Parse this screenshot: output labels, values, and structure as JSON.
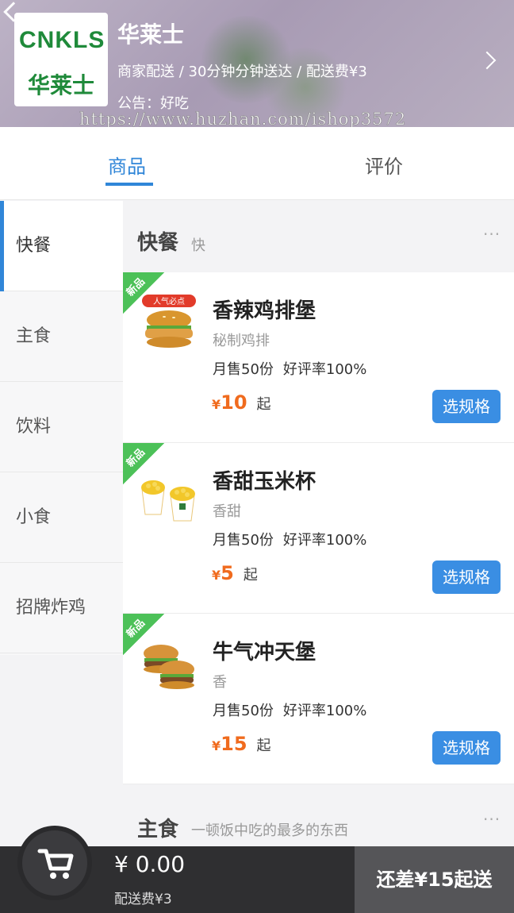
{
  "shop": {
    "logo_top": "CNKLS",
    "logo_bottom": "华莱士",
    "name": "华莱士",
    "info": "商家配送 / 30分钟分钟送达 / 配送费¥3",
    "notice": "公告：好吃",
    "watermark": "https://www.huzhan.com/ishop3572"
  },
  "tabs": {
    "goods": "商品",
    "review": "评价"
  },
  "sidebar": {
    "items": [
      {
        "label": "快餐"
      },
      {
        "label": "主食"
      },
      {
        "label": "饮料"
      },
      {
        "label": "小食"
      },
      {
        "label": "招牌炸鸡"
      }
    ]
  },
  "sections": [
    {
      "title": "快餐",
      "desc": "快",
      "more": "···",
      "items": [
        {
          "badge": "新品",
          "name": "香辣鸡排堡",
          "desc": "秘制鸡排",
          "sales": "月售50份",
          "rating": "好评率100%",
          "currency": "¥",
          "price": "10",
          "suffix": "起",
          "button": "选规格"
        },
        {
          "badge": "新品",
          "name": "香甜玉米杯",
          "desc": "香甜",
          "sales": "月售50份",
          "rating": "好评率100%",
          "currency": "¥",
          "price": "5",
          "suffix": "起",
          "button": "选规格"
        },
        {
          "badge": "新品",
          "name": "牛气冲天堡",
          "desc": "香",
          "sales": "月售50份",
          "rating": "好评率100%",
          "currency": "¥",
          "price": "15",
          "suffix": "起",
          "button": "选规格"
        }
      ]
    },
    {
      "title": "主食",
      "desc": "一顿饭中吃的最多的东西",
      "more": "···"
    }
  ],
  "cart": {
    "amount": "¥ 0.00",
    "fee": "配送费¥3",
    "submit": "还差¥15起送"
  },
  "colors": {
    "accent": "#3086d8",
    "price": "#f06b1e",
    "badge": "#4cc158",
    "cart_bg": "#2f2f31"
  },
  "icons": {
    "cart": "cart-icon",
    "chevron": "chevron-right-icon",
    "back": "back-icon"
  }
}
